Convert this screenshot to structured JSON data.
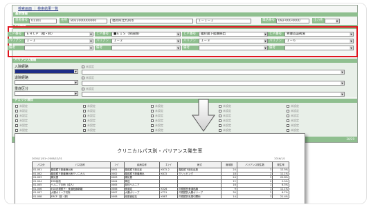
{
  "top_links": "検索画面  ｜  検索結果一覧",
  "sections": {
    "basic": "基本情報",
    "cp": "CP情報",
    "variance": "バリアンス情報",
    "checks": "チェック項目"
  },
  "basic": {
    "patient_id_label": "患者番号",
    "patient_id": "01101",
    "address_label": "住所",
    "postal": "8022000000000",
    "city": "福岡県北九州市",
    "address2": "１－１－１",
    "phone_label": "電話番号",
    "phone": "092-000-0000",
    "dept_label": "出力先",
    "dept": ""
  },
  "cp": {
    "cp_label": "ＣＰ番号",
    "variance_label": "バリアンス",
    "note_label": "備考",
    "columns": [
      {
        "cp": "ＥＲＣＰ（胆・膵）",
        "variance": "１－１"
      },
      {
        "cp": "■ＥＩＳ（食道静）",
        "variance": "１－２"
      },
      {
        "cp": "腹腔鏡下胆嚢摘出",
        "variance": "１－３"
      },
      {
        "cp": "胃瘻造設術施",
        "variance": "１－６"
      }
    ]
  },
  "variance_fields": {
    "field1_label": "入院経路",
    "field2_label": "退院経路",
    "field3_label": "重症区分",
    "unset": "未設定"
  },
  "checkbox_label": "未設定",
  "footer_count": "20/29",
  "arrow": "down-arrow",
  "doc": {
    "title": "クリニカルパス別・バリアンス発生率",
    "range": "2005/11/01～2006/12/31",
    "printed": "2016/1/1",
    "headers": [
      "パス分",
      "パス名称",
      "ｺｰﾄﾞ",
      "疾病名称",
      "Ｉｺｰﾄﾞ",
      "術式",
      "適用数",
      "バリアンス発生数",
      "発生率"
    ],
    "rows": [
      [
        "01-001",
        "腹腔鏡下胆嚢摘出術",
        "0001",
        "腹腔鏡下胆石症",
        "K672-2",
        "腹腔鏡下胆石症胆",
        "24",
        "3",
        "12.5%"
      ],
      [
        "01-002",
        "腹腔鏡下胆嚢摘出術クリニカル",
        "0002",
        "腹腔鏡下胆嚢摘出",
        "K672",
        "クリッピング",
        "18",
        "2",
        "11.1%"
      ],
      [
        "01-003",
        "腸処置",
        "0003",
        "腸処置",
        "",
        "",
        "24",
        "5",
        "20.8%"
      ],
      [
        "01-004",
        "ESD術前",
        "0004",
        "胃癌",
        "",
        "",
        "12",
        "0",
        "0.0%"
      ],
      [
        "01-005",
        "ヘルニア手術（成人）",
        "0005",
        "鼠径ヘルニア",
        "",
        "",
        "16",
        "1",
        "6.3%"
      ],
      [
        "01-006",
        "ESD内視鏡下・食道粘膜剥離",
        "0006",
        "食道癌",
        "K526",
        "内視鏡的食道粘膜",
        "9",
        "1",
        "11.1%"
      ],
      [
        "01-007",
        "大腸ポリープ切除",
        "0007",
        "大腸ポリープ",
        "K721",
        "内視鏡的大腸ポリープ",
        "30",
        "2",
        "6.7%"
      ],
      [
        "01-008",
        "ERCP（胆・膵）",
        "0008",
        "総胆管結石",
        "K687",
        "内視鏡的乳頭切開術",
        "14",
        "3",
        "21.4%"
      ]
    ]
  }
}
